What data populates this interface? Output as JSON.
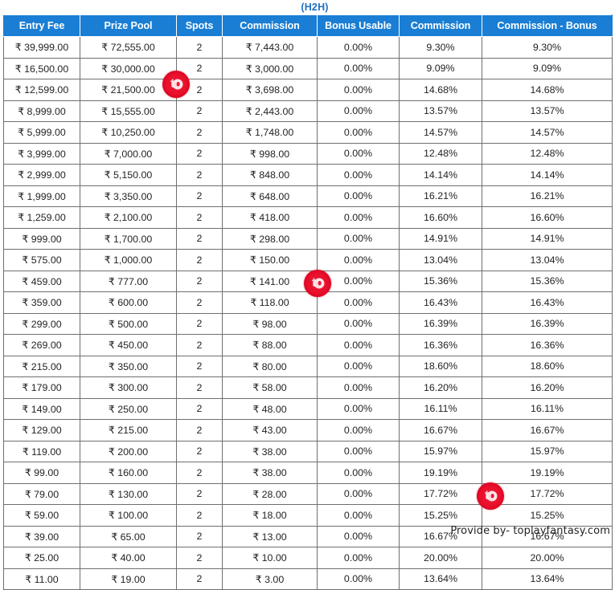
{
  "title": "(H2H)",
  "accent_color": "#1a7ed4",
  "title_color": "#1f6fc4",
  "watermark_color": "#e8102b",
  "watermark_label": "to",
  "footer": "Provide by- toplayfantasy.com",
  "table": {
    "columns": [
      "Entry Fee",
      "Prize Pool",
      "Spots",
      "Commission",
      "Bonus Usable",
      "Commission",
      "Commission - Bonus"
    ],
    "rows": [
      [
        "₹ 39,999.00",
        "₹ 72,555.00",
        "2",
        "₹ 7,443.00",
        "0.00%",
        "9.30%",
        "9.30%"
      ],
      [
        "₹ 16,500.00",
        "₹ 30,000.00",
        "2",
        "₹ 3,000.00",
        "0.00%",
        "9.09%",
        "9.09%"
      ],
      [
        "₹ 12,599.00",
        "₹ 21,500.00",
        "2",
        "₹ 3,698.00",
        "0.00%",
        "14.68%",
        "14.68%"
      ],
      [
        "₹ 8,999.00",
        "₹ 15,555.00",
        "2",
        "₹ 2,443.00",
        "0.00%",
        "13.57%",
        "13.57%"
      ],
      [
        "₹ 5,999.00",
        "₹ 10,250.00",
        "2",
        "₹ 1,748.00",
        "0.00%",
        "14.57%",
        "14.57%"
      ],
      [
        "₹ 3,999.00",
        "₹ 7,000.00",
        "2",
        "₹ 998.00",
        "0.00%",
        "12.48%",
        "12.48%"
      ],
      [
        "₹ 2,999.00",
        "₹ 5,150.00",
        "2",
        "₹ 848.00",
        "0.00%",
        "14.14%",
        "14.14%"
      ],
      [
        "₹ 1,999.00",
        "₹ 3,350.00",
        "2",
        "₹ 648.00",
        "0.00%",
        "16.21%",
        "16.21%"
      ],
      [
        "₹ 1,259.00",
        "₹ 2,100.00",
        "2",
        "₹ 418.00",
        "0.00%",
        "16.60%",
        "16.60%"
      ],
      [
        "₹ 999.00",
        "₹ 1,700.00",
        "2",
        "₹ 298.00",
        "0.00%",
        "14.91%",
        "14.91%"
      ],
      [
        "₹ 575.00",
        "₹ 1,000.00",
        "2",
        "₹ 150.00",
        "0.00%",
        "13.04%",
        "13.04%"
      ],
      [
        "₹ 459.00",
        "₹ 777.00",
        "2",
        "₹ 141.00",
        "0.00%",
        "15.36%",
        "15.36%"
      ],
      [
        "₹ 359.00",
        "₹ 600.00",
        "2",
        "₹ 118.00",
        "0.00%",
        "16.43%",
        "16.43%"
      ],
      [
        "₹ 299.00",
        "₹ 500.00",
        "2",
        "₹ 98.00",
        "0.00%",
        "16.39%",
        "16.39%"
      ],
      [
        "₹ 269.00",
        "₹ 450.00",
        "2",
        "₹ 88.00",
        "0.00%",
        "16.36%",
        "16.36%"
      ],
      [
        "₹ 215.00",
        "₹ 350.00",
        "2",
        "₹ 80.00",
        "0.00%",
        "18.60%",
        "18.60%"
      ],
      [
        "₹ 179.00",
        "₹ 300.00",
        "2",
        "₹ 58.00",
        "0.00%",
        "16.20%",
        "16.20%"
      ],
      [
        "₹ 149.00",
        "₹ 250.00",
        "2",
        "₹ 48.00",
        "0.00%",
        "16.11%",
        "16.11%"
      ],
      [
        "₹ 129.00",
        "₹ 215.00",
        "2",
        "₹ 43.00",
        "0.00%",
        "16.67%",
        "16.67%"
      ],
      [
        "₹ 119.00",
        "₹ 200.00",
        "2",
        "₹ 38.00",
        "0.00%",
        "15.97%",
        "15.97%"
      ],
      [
        "₹ 99.00",
        "₹ 160.00",
        "2",
        "₹ 38.00",
        "0.00%",
        "19.19%",
        "19.19%"
      ],
      [
        "₹ 79.00",
        "₹ 130.00",
        "2",
        "₹ 28.00",
        "0.00%",
        "17.72%",
        "17.72%"
      ],
      [
        "₹ 59.00",
        "₹ 100.00",
        "2",
        "₹ 18.00",
        "0.00%",
        "15.25%",
        "15.25%"
      ],
      [
        "₹ 39.00",
        "₹ 65.00",
        "2",
        "₹ 13.00",
        "0.00%",
        "16.67%",
        "16.67%"
      ],
      [
        "₹ 25.00",
        "₹ 40.00",
        "2",
        "₹ 10.00",
        "0.00%",
        "20.00%",
        "20.00%"
      ],
      [
        "₹ 11.00",
        "₹ 19.00",
        "2",
        "₹ 3.00",
        "0.00%",
        "13.64%",
        "13.64%"
      ]
    ]
  }
}
